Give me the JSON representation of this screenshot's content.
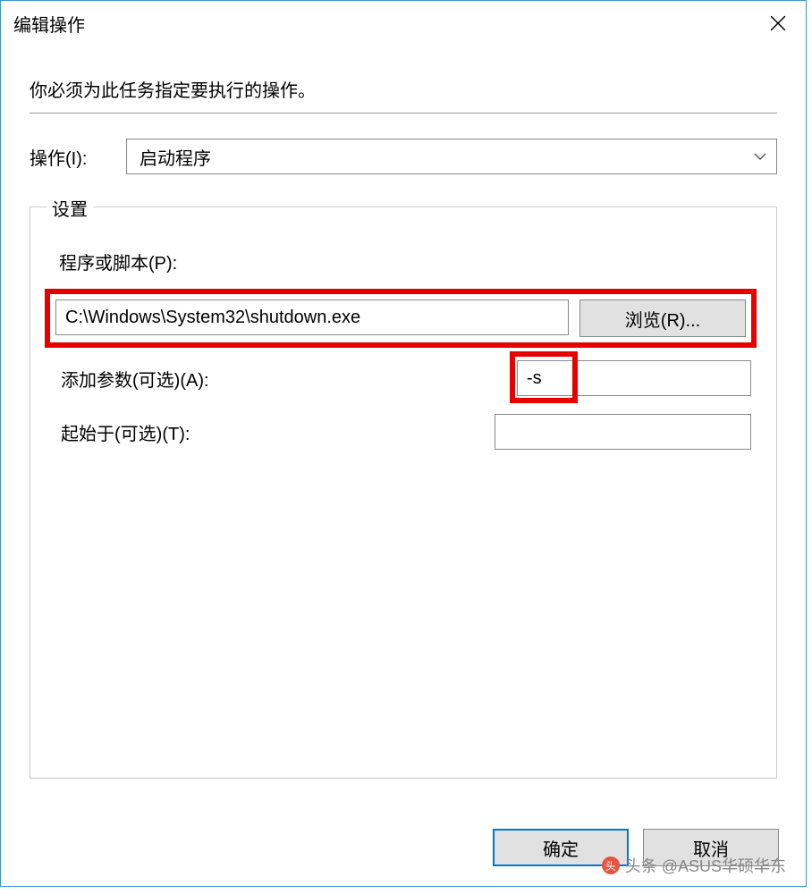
{
  "window": {
    "title": "编辑操作"
  },
  "instruction": "你必须为此任务指定要执行的操作。",
  "action": {
    "label": "操作(I):",
    "selected": "启动程序"
  },
  "settings": {
    "legend": "设置",
    "program_label": "程序或脚本(P):",
    "program_value": "C:\\Windows\\System32\\shutdown.exe",
    "browse_label": "浏览(R)...",
    "args_label": "添加参数(可选)(A):",
    "args_value": "-s",
    "startin_label": "起始于(可选)(T):",
    "startin_value": ""
  },
  "buttons": {
    "ok": "确定",
    "cancel": "取消"
  },
  "watermark": "头条 @ASUS华硕华东"
}
